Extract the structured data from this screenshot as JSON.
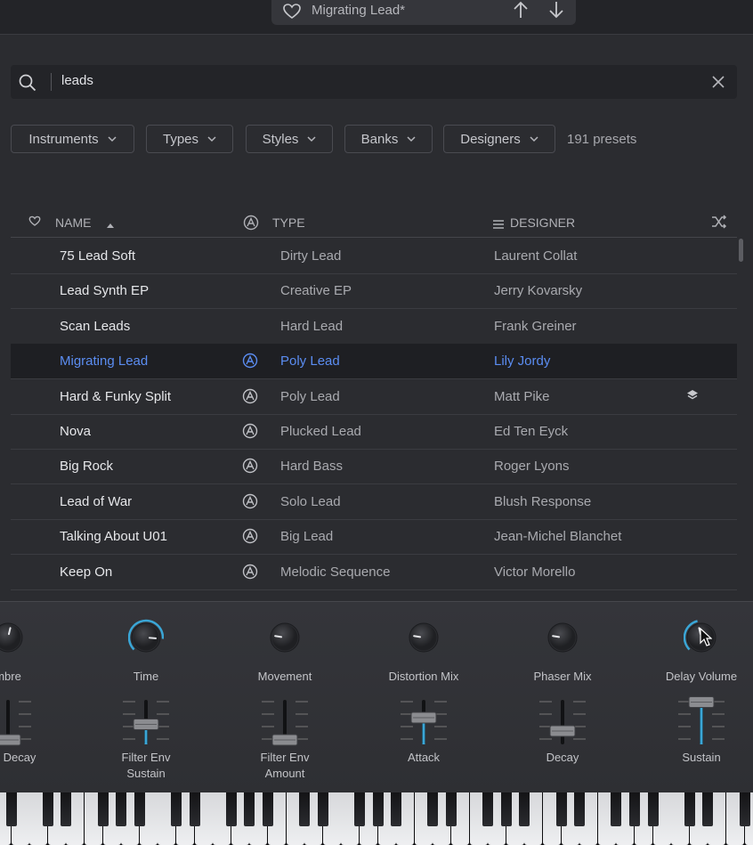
{
  "header": {
    "preset_name": "Migrating Lead*"
  },
  "search": {
    "query": "leads"
  },
  "filters": {
    "instruments": "Instruments",
    "types": "Types",
    "styles": "Styles",
    "banks": "Banks",
    "designers": "Designers",
    "count": "191 presets"
  },
  "table": {
    "headers": {
      "name": "NAME",
      "type": "TYPE",
      "designer": "DESIGNER"
    },
    "rows": [
      {
        "name": "75 Lead Soft",
        "type": "Dirty Lead",
        "designer": "Laurent Collat",
        "badge": false,
        "selected": false
      },
      {
        "name": "Lead Synth EP",
        "type": "Creative EP",
        "designer": "Jerry Kovarsky",
        "badge": false,
        "selected": false
      },
      {
        "name": "Scan Leads",
        "type": "Hard Lead",
        "designer": "Frank Greiner",
        "badge": false,
        "selected": false
      },
      {
        "name": "Migrating Lead",
        "type": "Poly Lead",
        "designer": "Lily Jordy",
        "badge": true,
        "selected": true
      },
      {
        "name": "Hard & Funky Split",
        "type": "Poly Lead",
        "designer": "Matt Pike",
        "badge": true,
        "selected": false,
        "layers_icon": true
      },
      {
        "name": "Nova",
        "type": "Plucked Lead",
        "designer": "Ed Ten Eyck",
        "badge": true,
        "selected": false
      },
      {
        "name": "Big Rock",
        "type": "Hard Bass",
        "designer": "Roger Lyons",
        "badge": true,
        "selected": false
      },
      {
        "name": "Lead of War",
        "type": "Solo Lead",
        "designer": "Blush Response",
        "badge": true,
        "selected": false
      },
      {
        "name": "Talking About U01",
        "type": "Big Lead",
        "designer": "Jean-Michel Blanchet",
        "badge": true,
        "selected": false
      },
      {
        "name": "Keep On",
        "type": "Melodic Sequence",
        "designer": "Victor Morello",
        "badge": true,
        "selected": false
      }
    ]
  },
  "macros": {
    "knobs": [
      {
        "label": "mbre",
        "level": 0.55
      },
      {
        "label": "Time",
        "level": 0.85
      },
      {
        "label": "Movement",
        "level": 0.2
      },
      {
        "label": "Distortion Mix",
        "level": 0.2
      },
      {
        "label": "Phaser Mix",
        "level": 0.2
      },
      {
        "label": "Delay Volume",
        "level": 0.45
      }
    ],
    "faders": [
      {
        "label": "Env Decay",
        "level": 0.1
      },
      {
        "label": "Filter Env\nSustain",
        "level": 0.45
      },
      {
        "label": "Filter Env\nAmount",
        "level": 0.1
      },
      {
        "label": "Attack",
        "level": 0.6
      },
      {
        "label": "Decay",
        "level": 0.3
      },
      {
        "label": "Sustain",
        "level": 0.95
      }
    ]
  },
  "colors": {
    "accent": "#5b8df2",
    "knob_ring": "#3aa6d6",
    "background": "#2b2c30"
  }
}
